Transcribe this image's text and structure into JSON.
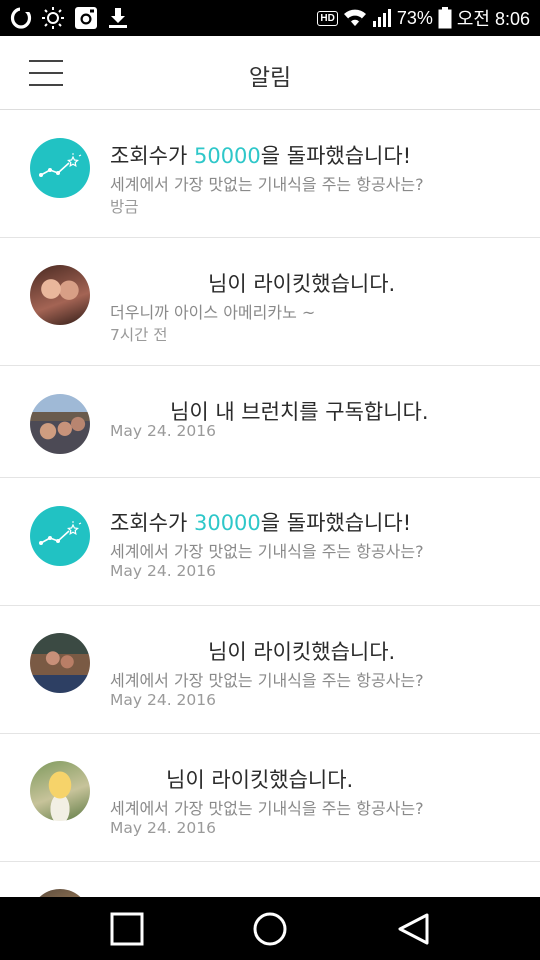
{
  "status_bar": {
    "battery": "73%",
    "time": "오전 8:06",
    "hd": "HD",
    "icons": [
      "opera-icon",
      "brightness-icon",
      "instagram-icon",
      "download-icon",
      "hd-icon",
      "wifi-icon",
      "signal-icon",
      "battery-icon"
    ]
  },
  "header": {
    "title": "알림",
    "menu_icon": "hamburger-menu-icon"
  },
  "notifications": [
    {
      "avatar": "chart-star-icon",
      "accent_color": "#21c2c3",
      "prefix": "조회수가 ",
      "highlight": "50000",
      "suffix": "을 돌파했습니다!",
      "subtitle": "세계에서 가장 맛없는 기내식을 주는 항공사는?",
      "time": "방금"
    },
    {
      "avatar": "user-photo",
      "message": "님이 라이킷했습니다.",
      "subtitle": "더우니까 아이스 아메리카노 ~",
      "time": "7시간 전"
    },
    {
      "avatar": "user-photo",
      "message": "님이 내 브런치를 구독합니다.",
      "time": "May 24. 2016"
    },
    {
      "avatar": "chart-star-icon",
      "accent_color": "#21c2c3",
      "prefix": "조회수가 ",
      "highlight": "30000",
      "suffix": "을 돌파했습니다!",
      "subtitle": "세계에서 가장 맛없는 기내식을 주는 항공사는?",
      "time": "May 24. 2016"
    },
    {
      "avatar": "user-photo",
      "message": "님이 라이킷했습니다.",
      "subtitle": "세계에서 가장 맛없는 기내식을 주는 항공사는?",
      "time": "May 24. 2016"
    },
    {
      "avatar": "user-photo",
      "message": "님이 라이킷했습니다.",
      "subtitle": "세계에서 가장 맛없는 기내식을 주는 항공사는?",
      "time": "May 24. 2016"
    },
    {
      "avatar": "user-photo"
    }
  ],
  "nav_bar": {
    "icons": [
      "recent-apps-icon",
      "home-icon",
      "back-icon"
    ]
  }
}
